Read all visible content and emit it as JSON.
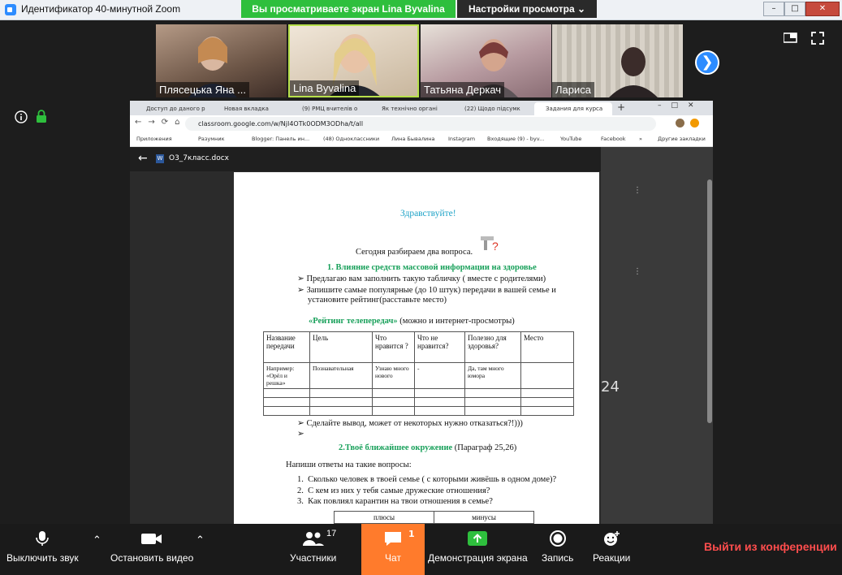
{
  "window": {
    "title": "Идентификатор 40-минутной Zoom",
    "share_banner": "Вы просматриваете экран Lina Byvalina",
    "view_options": "Настройки просмотра",
    "controls": [
      "–",
      "□",
      "✕"
    ]
  },
  "participants_strip": [
    {
      "name": "Плясецька Яна ..."
    },
    {
      "name": "Lina Byvalina"
    },
    {
      "name": "Татьяна Деркач"
    },
    {
      "name": "Лариса"
    }
  ],
  "browser": {
    "tabs": [
      {
        "label": "Доступ до даного р"
      },
      {
        "label": "Новая вкладка"
      },
      {
        "label": "(9) РМЦ вчителів о"
      },
      {
        "label": "Як технічно органі"
      },
      {
        "label": "(22) Щодо підсумк"
      },
      {
        "label": "Задания для курса"
      }
    ],
    "url": "classroom.google.com/w/NjI4OTk0ODM3ODha/t/all",
    "bookmarks": [
      "Приложения",
      "Разумник",
      "Blogger: Панель ин...",
      "(48) Одноклассники",
      "Лина Бывалина",
      "Instagram",
      "Входящие (9) - byv...",
      "YouTube",
      "Facebook",
      "»",
      "Другие закладки"
    ]
  },
  "doc": {
    "filename": "О3_7класс.docx",
    "greeting": "Здравствуйте!",
    "intro": "Сегодня разбираем два вопроса.",
    "section1": "1.  Влияние средств массовой информации на здоровье",
    "bullet1": "Предлагаю вам заполнить такую табличку ( вместе с родителями)",
    "bullet2a": "Запишите самые популярные (до 10 штук) передачи в вашей семье и",
    "bullet2b": "установите рейтинг(расставьте место)",
    "rating_title": "«Рейтинг телепередач»",
    "rating_note": " (можно и интернет-просмотры)",
    "table_headers": [
      "Название передачи",
      "Цель",
      "Что нравится ?",
      "Что не нравится?",
      "Полезно для здоровья?",
      "Место"
    ],
    "table_example": [
      "Например: «Орёл и решка»",
      "Познавательная",
      "Узнаю много нового",
      "-",
      "Да, там много юмора",
      ""
    ],
    "bullet3": "Сделайте вывод, может от некоторых нужно отказаться?!)))",
    "section2": "2.Твоё ближайшее окружение",
    "section2_note": " (Параграф 25,26)",
    "questions_intro": "Напиши ответы на такие вопросы:",
    "q1": "Сколько человек в твоей семье ( с которыми живёшь в одном доме)?",
    "q2": "С кем из них у тебя самые дружеские отношения?",
    "q3": "Как повлиял карантин на твои отношения в семье?",
    "pluses": "плюсы",
    "minuses": "минусы",
    "side_number": "24"
  },
  "toolbar": {
    "mute": "Выключить звук",
    "stop_video": "Остановить видео",
    "participants": "Участники",
    "participants_count": "17",
    "chat": "Чат",
    "chat_badge": "1",
    "share": "Демонстрация экрана",
    "record": "Запись",
    "reactions": "Реакции",
    "leave": "Выйти из конференции"
  },
  "colors": {
    "accent_green": "#2ebf3d",
    "chat_orange": "#ff7b2c",
    "leave_red": "#ff4d4d",
    "zoom_blue": "#2d8cff",
    "doc_green": "#18a05a",
    "doc_cyan": "#1fa3c7"
  }
}
